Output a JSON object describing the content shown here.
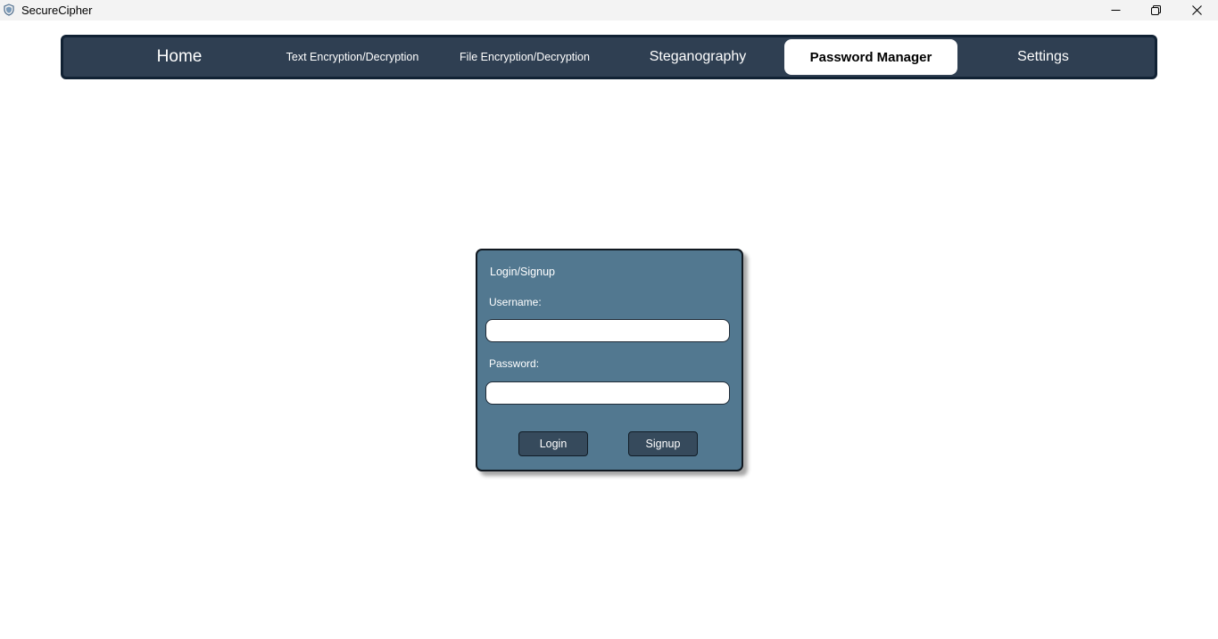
{
  "window": {
    "title": "SecureCipher",
    "icon": "shield-icon",
    "controls": [
      "minimize-icon",
      "restore-icon",
      "close-icon"
    ]
  },
  "nav": {
    "tabs": [
      {
        "label": "Home",
        "active": false
      },
      {
        "label": "Text Encryption/Decryption",
        "active": false
      },
      {
        "label": "File Encryption/Decryption",
        "active": false
      },
      {
        "label": "Steganography",
        "active": false
      },
      {
        "label": "Password Manager",
        "active": true
      },
      {
        "label": "Settings",
        "active": false
      }
    ]
  },
  "login_panel": {
    "title": "Login/Signup",
    "username_label": "Username:",
    "username_value": "",
    "password_label": "Password:",
    "password_value": "",
    "login_button": "Login",
    "signup_button": "Signup"
  },
  "colors": {
    "nav_background": "#2f3f52",
    "nav_border": "#112234",
    "panel_background": "#527890",
    "button_background": "#364a5c",
    "active_tab_background": "#ffffff"
  }
}
